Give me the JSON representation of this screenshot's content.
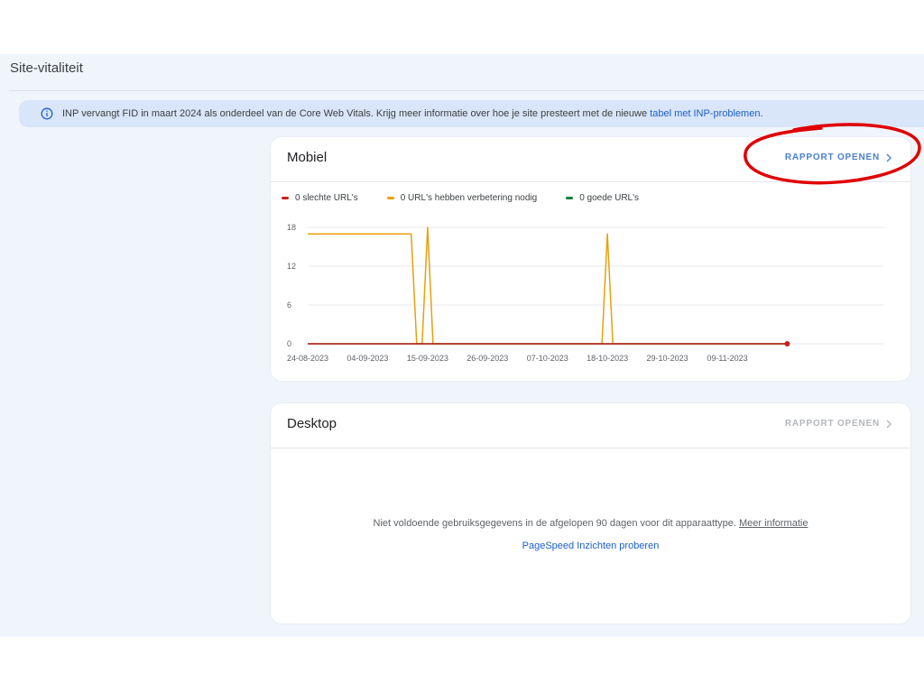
{
  "page": {
    "title": "Site-vitaliteit"
  },
  "banner": {
    "icon": "info-icon",
    "text": "INP vervangt FID in maart 2024 als onderdeel van de Core Web Vitals. Krijg meer informatie over hoe je site presteert met de nieuwe ",
    "link_text": "tabel met INP-problemen",
    "link_suffix": "."
  },
  "mobile": {
    "title": "Mobiel",
    "report_button": "RAPPORT OPENEN",
    "legend": [
      {
        "label": "0 slechte URL's",
        "color": "#c5221f"
      },
      {
        "label": "0 URL's hebben verbetering nodig",
        "color": "#e8a00c"
      },
      {
        "label": "0 goede URL's",
        "color": "#188038"
      }
    ]
  },
  "desktop": {
    "title": "Desktop",
    "report_button": "RAPPORT OPENEN",
    "message": "Niet voldoende gebruiksgegevens in de afgelopen 90 dagen voor dit apparaattype. ",
    "message_link": "Meer informatie",
    "pagespeed_link": "PageSpeed Inzichten proberen"
  },
  "annotation": {
    "type": "red-ellipse-highlight",
    "color": "#e00000"
  },
  "chart_data": {
    "type": "line",
    "title": "",
    "xlabel": "",
    "ylabel": "",
    "ylim": [
      0,
      18
    ],
    "yticks": [
      "18",
      "12",
      "6",
      "0"
    ],
    "xticks": [
      "24-08-2023",
      "04-09-2023",
      "15-09-2023",
      "26-09-2023",
      "07-10-2023",
      "18-10-2023",
      "29-10-2023",
      "09-11-2023"
    ],
    "grid": true,
    "legend_position": "top-left",
    "series": [
      {
        "name": "0 slechte URL's",
        "color": "#c5221f",
        "points": [
          [
            "2023-08-24",
            0
          ],
          [
            "2023-11-20",
            0
          ]
        ]
      },
      {
        "name": "0 URL's hebben verbetering nodig",
        "color": "#e8a00c",
        "points": [
          [
            "2023-08-24",
            17
          ],
          [
            "2023-09-12",
            17
          ],
          [
            "2023-09-13",
            0
          ],
          [
            "2023-09-14",
            0
          ],
          [
            "2023-09-15",
            18
          ],
          [
            "2023-09-16",
            0
          ],
          [
            "2023-10-17",
            0
          ],
          [
            "2023-10-18",
            17
          ],
          [
            "2023-10-19",
            0
          ],
          [
            "2023-11-20",
            0
          ]
        ]
      },
      {
        "name": "0 goede URL's",
        "color": "#188038",
        "points": [
          [
            "2023-08-24",
            0
          ],
          [
            "2023-11-20",
            0
          ]
        ]
      }
    ]
  }
}
